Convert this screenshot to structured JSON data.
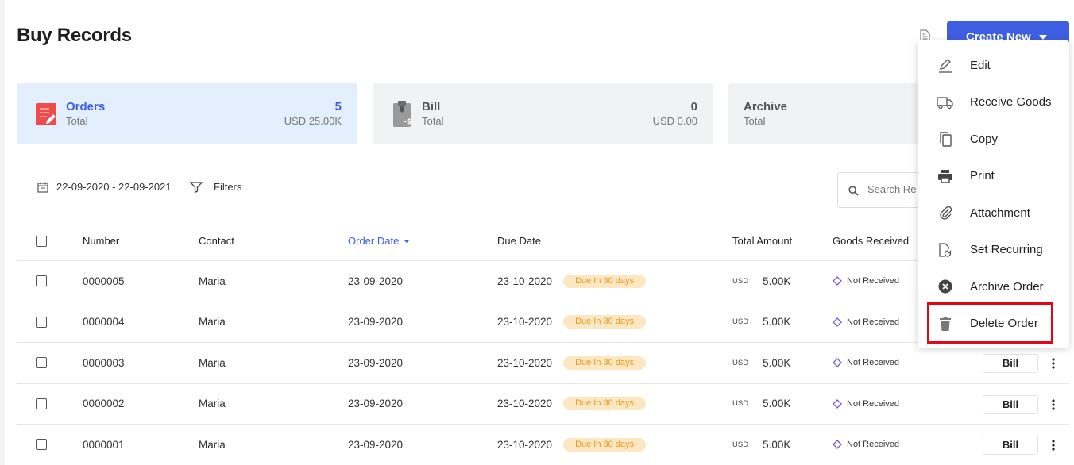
{
  "page": {
    "title": "Buy Records"
  },
  "header": {
    "create_label": "Create New"
  },
  "cards": [
    {
      "title": "Orders",
      "sub": "Total",
      "count": "5",
      "amount": "USD 25.00K"
    },
    {
      "title": "Bill",
      "sub": "Total",
      "count": "0",
      "amount": "USD 0.00"
    },
    {
      "title": "Archive",
      "sub": "Total"
    }
  ],
  "filters": {
    "date_range": "22-09-2020 - 22-09-2021",
    "filters_label": "Filters"
  },
  "search": {
    "placeholder": "Search Re"
  },
  "table": {
    "headers": {
      "number": "Number",
      "contact": "Contact",
      "order_date": "Order Date",
      "due_date": "Due Date",
      "total": "Total Amount",
      "goods": "Goods Received"
    },
    "rows": [
      {
        "number": "0000005",
        "contact": "Maria",
        "order_date": "23-09-2020",
        "due_date": "23-10-2020",
        "due_badge": "Due In 30 days",
        "currency": "USD",
        "amount": "5.00K",
        "goods": "Not Received"
      },
      {
        "number": "0000004",
        "contact": "Maria",
        "order_date": "23-09-2020",
        "due_date": "23-10-2020",
        "due_badge": "Due In 30 days",
        "currency": "USD",
        "amount": "5.00K",
        "goods": "Not Received"
      },
      {
        "number": "0000003",
        "contact": "Maria",
        "order_date": "23-09-2020",
        "due_date": "23-10-2020",
        "due_badge": "Due In 30 days",
        "currency": "USD",
        "amount": "5.00K",
        "goods": "Not Received",
        "action": "Bill"
      },
      {
        "number": "0000002",
        "contact": "Maria",
        "order_date": "23-09-2020",
        "due_date": "23-10-2020",
        "due_badge": "Due In 30 days",
        "currency": "USD",
        "amount": "5.00K",
        "goods": "Not Received",
        "action": "Bill"
      },
      {
        "number": "0000001",
        "contact": "Maria",
        "order_date": "23-09-2020",
        "due_date": "23-10-2020",
        "due_badge": "Due In 30 days",
        "currency": "USD",
        "amount": "5.00K",
        "goods": "Not Received",
        "action": "Bill"
      }
    ]
  },
  "menu": {
    "items": [
      {
        "label": "Edit",
        "icon": "pencil-icon"
      },
      {
        "label": "Receive Goods",
        "icon": "truck-icon"
      },
      {
        "label": "Copy",
        "icon": "copy-icon"
      },
      {
        "label": "Print",
        "icon": "printer-icon"
      },
      {
        "label": "Attachment",
        "icon": "paperclip-icon"
      },
      {
        "label": "Set Recurring",
        "icon": "recurring-document-icon"
      },
      {
        "label": "Archive Order",
        "icon": "archive-x-icon"
      },
      {
        "label": "Delete Order",
        "icon": "trash-icon"
      }
    ]
  },
  "colors": {
    "accent": "#3d5ee0",
    "due_badge_bg": "#fde6c2",
    "due_badge_text": "#e59a1d",
    "highlight": "#e3061a",
    "orders_card_bg": "#e4effd"
  }
}
